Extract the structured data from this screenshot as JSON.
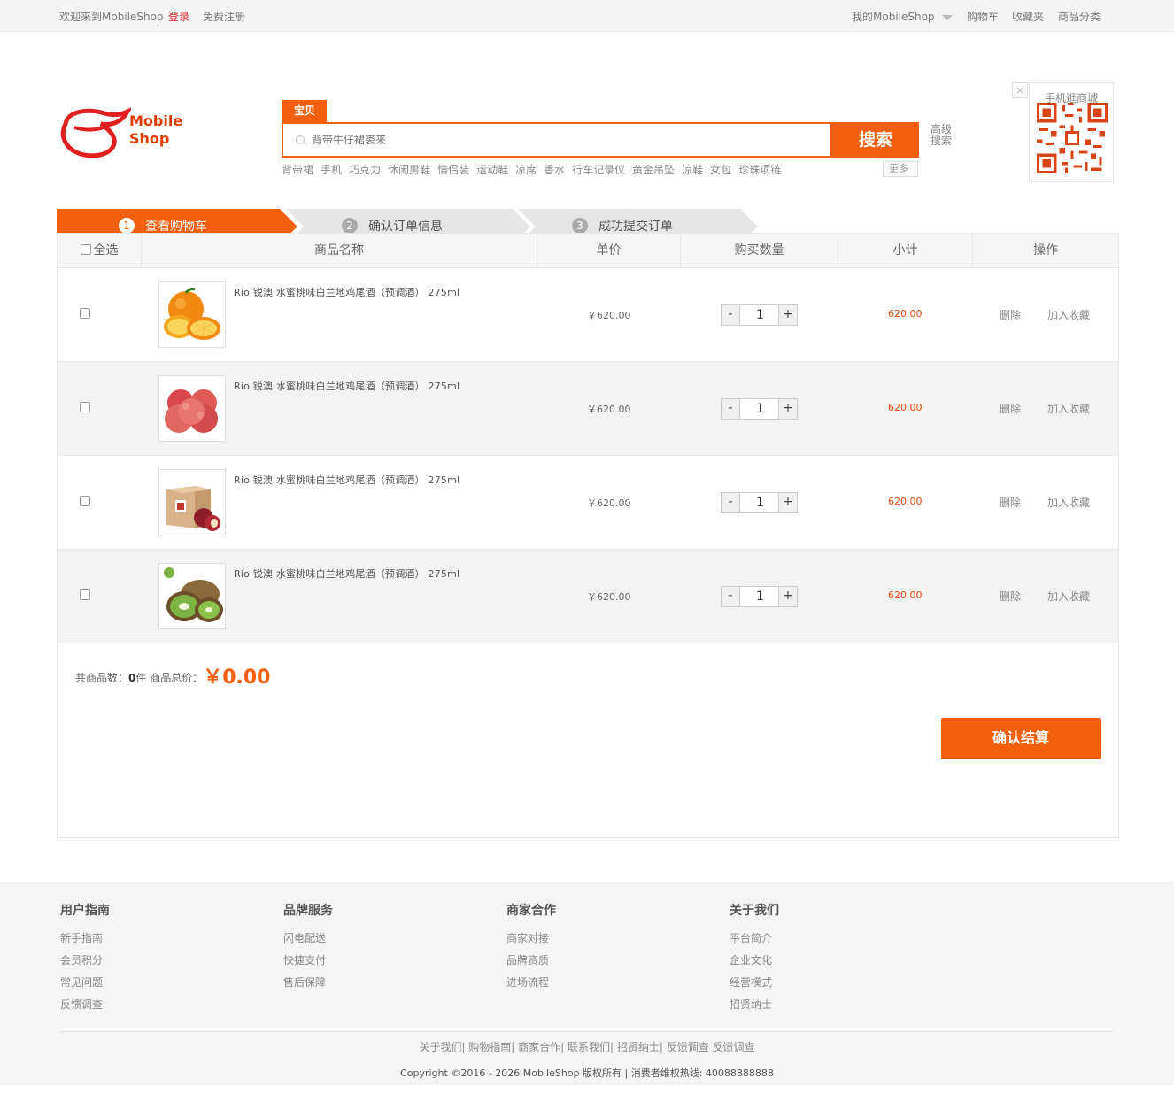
{
  "topbar": {
    "welcome": "欢迎来到MobileShop",
    "login": "登录",
    "register": "免费注册",
    "my_shop": "我的MobileShop",
    "cart": "购物车",
    "favorites": "收藏夹",
    "categories": "商品分类"
  },
  "header": {
    "logo_line1": "Mobile",
    "logo_line2": "Shop",
    "search_tab": "宝贝",
    "search_placeholder": "背带牛仔裙裘来",
    "search_button": "搜索",
    "advanced_search": "高级搜索",
    "hot_keywords": [
      "背带裙",
      "手机",
      "巧克力",
      "休闲男鞋",
      "情侣装",
      "运动鞋",
      "凉席",
      "香水",
      "行车记录仪",
      "黄金吊坠",
      "凉鞋",
      "女包",
      "珍珠项链"
    ],
    "more": "更多",
    "qr_title": "手机逛商城",
    "qr_close": "×"
  },
  "steps": [
    {
      "num": "1",
      "label": "查看购物车"
    },
    {
      "num": "2",
      "label": "确认订单信息"
    },
    {
      "num": "3",
      "label": "成功提交订单"
    }
  ],
  "cart": {
    "headers": {
      "select_all": "全选",
      "name": "商品名称",
      "price": "单价",
      "qty": "购买数量",
      "subtotal": "小计",
      "action": "操作"
    },
    "items": [
      {
        "name": "Rio 锐澳 水蜜桃味白兰地鸡尾酒（预调酒） 275ml",
        "price": "￥620.00",
        "qty": "1",
        "subtotal": "620.00",
        "delete": "删除",
        "favorite": "加入收藏",
        "image": "orange-image"
      },
      {
        "name": "Rio 锐澳 水蜜桃味白兰地鸡尾酒（预调酒） 275ml",
        "price": "￥620.00",
        "qty": "1",
        "subtotal": "620.00",
        "delete": "删除",
        "favorite": "加入收藏",
        "image": "apple-image"
      },
      {
        "name": "Rio 锐澳 水蜜桃味白兰地鸡尾酒（预调酒） 275ml",
        "price": "￥620.00",
        "qty": "1",
        "subtotal": "620.00",
        "delete": "删除",
        "favorite": "加入收藏",
        "image": "apple-gift-box-image"
      },
      {
        "name": "Rio 锐澳 水蜜桃味白兰地鸡尾酒（预调酒） 275ml",
        "price": "￥620.00",
        "qty": "1",
        "subtotal": "620.00",
        "delete": "删除",
        "favorite": "加入收藏",
        "image": "kiwi-image"
      }
    ],
    "minus": "-",
    "plus": "+",
    "summary_count_label": "共商品数：",
    "summary_count": "0",
    "summary_count_unit": "件 商品总价：",
    "summary_total": "￥0.00",
    "checkout": "确认结算"
  },
  "footer": {
    "columns": [
      {
        "title": "用户指南",
        "links": [
          "新手指南",
          "会员积分",
          "常见问题",
          "反馈调查"
        ]
      },
      {
        "title": "品牌服务",
        "links": [
          "闪电配送",
          "快捷支付",
          "售后保障"
        ]
      },
      {
        "title": "商家合作",
        "links": [
          "商家对接",
          "品牌资质",
          "进场流程"
        ]
      },
      {
        "title": "关于我们",
        "links": [
          "平台简介",
          "企业文化",
          "经营模式",
          "招贤纳士"
        ]
      }
    ],
    "bottom_links": "关于我们| 购物指南| 商家合作| 联系我们| 招贤纳士| 反馈调查 反馈调查",
    "copyright": "Copyright ©2016 - 2026 MobileShop 版权所有 | 消费者维权热线: 40088888888"
  },
  "colors": {
    "accent": "#f25f0d",
    "price_red": "#e8490a",
    "login_red": "#d4282d"
  }
}
